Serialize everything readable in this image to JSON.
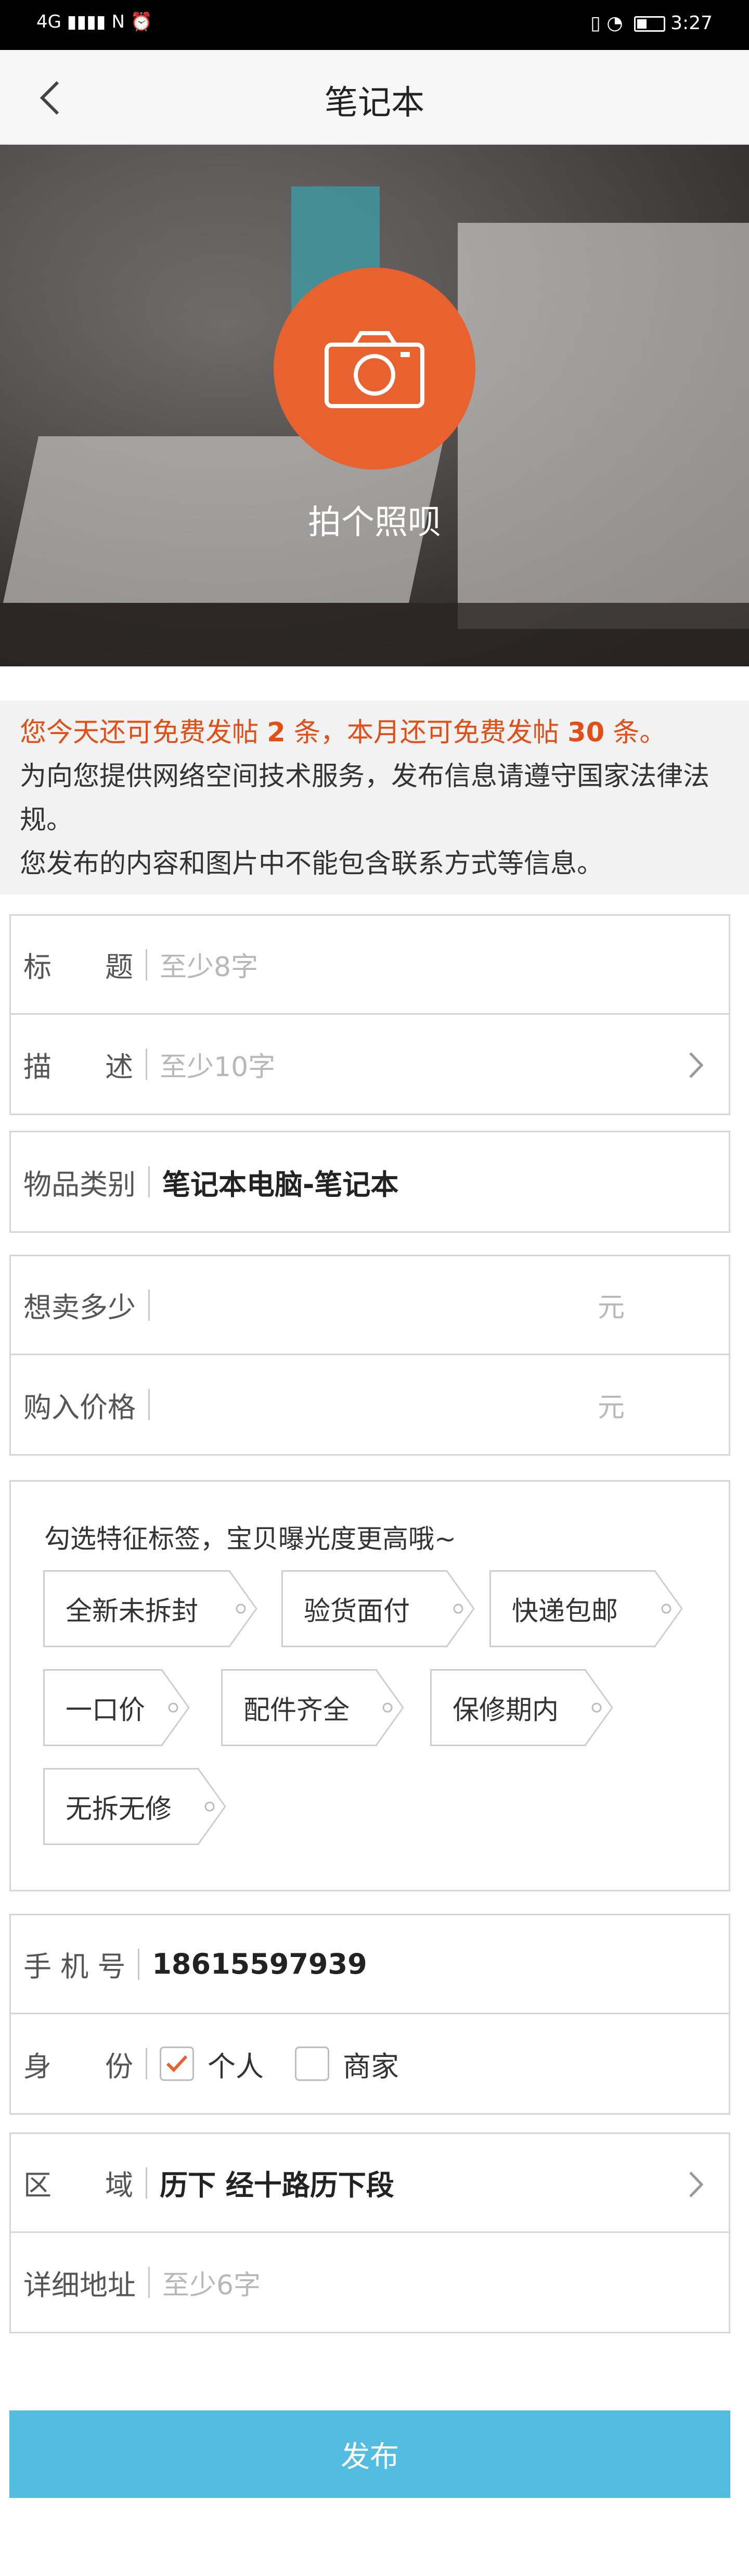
{
  "status_bar": {
    "network": "4G",
    "time": "3:27"
  },
  "nav": {
    "title": "笔记本",
    "back_icon": "chevron-left-icon"
  },
  "hero": {
    "caption": "拍个照呗",
    "camera_icon": "camera-icon",
    "accent": "#e8622f"
  },
  "notice": {
    "highlight": "您今天还可免费发帖 2 条，本月还可免费发帖 30 条。",
    "line_service": "为向您提供网络空间技术服务，发布信息请遵守国家法律法规。",
    "line_contact": "您发布的内容和图片中不能包含联系方式等信息。"
  },
  "form": {
    "title_label": "标      题",
    "title_placeholder": "至少8字",
    "desc_label": "描      述",
    "desc_placeholder": "至少10字",
    "category_label": "物品类别",
    "category_value": "笔记本电脑-笔记本",
    "sell_label": "想卖多少",
    "buy_label": "购入价格",
    "unit": "元",
    "phone_label": "手 机 号",
    "phone_value": "18615597939",
    "identity_label": "身      份",
    "identity_options": [
      {
        "label": "个人",
        "checked": true
      },
      {
        "label": "商家",
        "checked": false
      }
    ],
    "area_label": "区      域",
    "area_value": "历下 经十路历下段",
    "address_label": "详细地址",
    "address_placeholder": "至少6字"
  },
  "tags": {
    "hint": "勾选特征标签，宝贝曝光度更高哦~",
    "items": [
      "全新未拆封",
      "验货面付",
      "快递包邮",
      "一口价",
      "配件齐全",
      "保修期内",
      "无拆无修"
    ]
  },
  "publish_label": "发布",
  "colors": {
    "publish": "#52bde0",
    "highlight": "#e14e16",
    "check": "#e8622f"
  }
}
